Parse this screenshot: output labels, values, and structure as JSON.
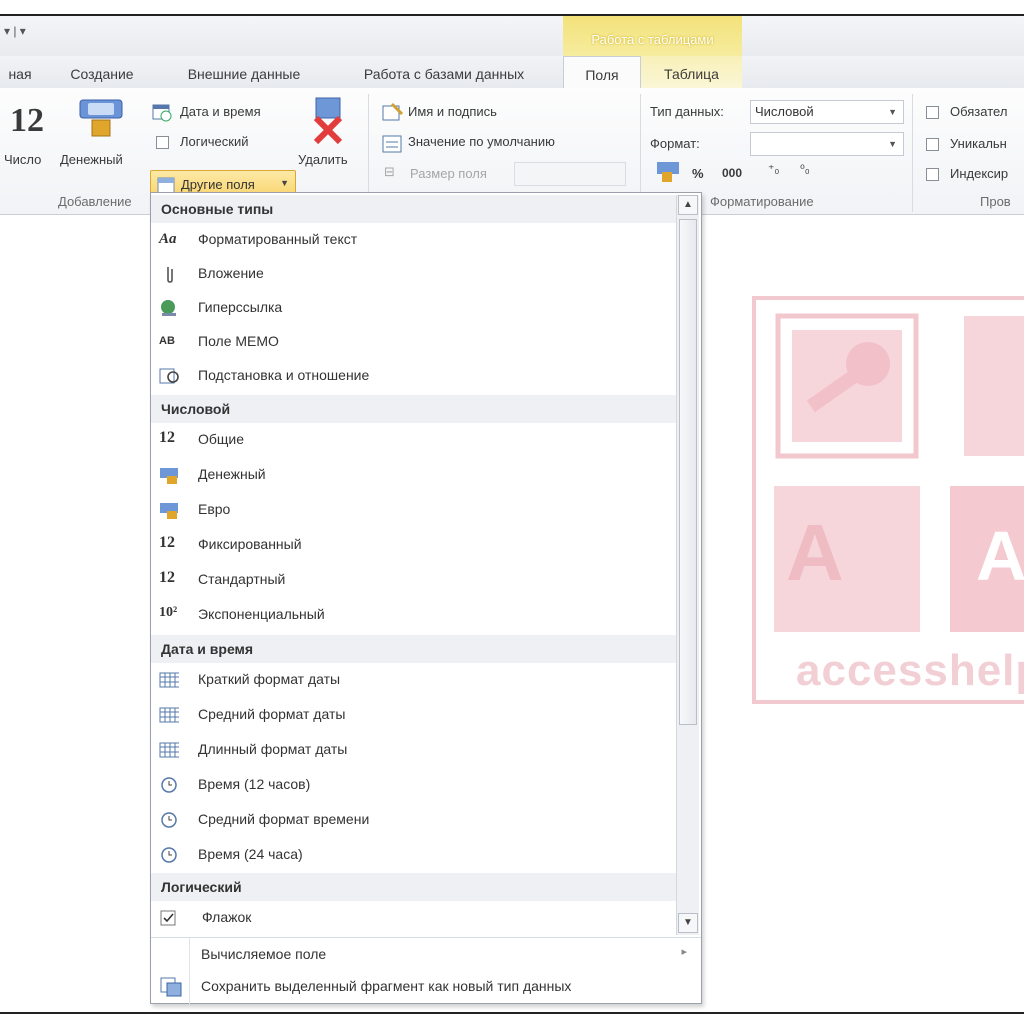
{
  "titlebar": {
    "qat": "▾ | ▾",
    "context_group": "Работа с таблицами"
  },
  "tabs": [
    {
      "label": "ная",
      "active": false
    },
    {
      "label": "Создание",
      "active": false
    },
    {
      "label": "Внешние данные",
      "active": false
    },
    {
      "label": "Работа с базами данных",
      "active": false
    },
    {
      "label": "Поля",
      "active": true
    },
    {
      "label": "Таблица",
      "active": false
    }
  ],
  "ribbon": {
    "add_delete": {
      "number_glyph": "12",
      "number_label": "Число",
      "currency_label": "Денежный",
      "date_time_label": "Дата и время",
      "logical_label": "Логический",
      "other_fields_label": "Другие поля",
      "delete_label": "Удалить",
      "group_label": "Добавление"
    },
    "properties": {
      "name_caption_label": "Имя и подпись",
      "default_value_label": "Значение по умолчанию",
      "field_size_label": "Размер поля"
    },
    "formatting": {
      "data_type_label": "Тип данных:",
      "data_type_value": "Числовой",
      "format_label": "Формат:",
      "format_value": "",
      "percent": "%",
      "thousands": "000",
      "group_label": "Форматирование"
    },
    "validation": {
      "required_label": "Обязател",
      "unique_label": "Уникальн",
      "indexed_label": "Индексир",
      "group_label": "Пров"
    }
  },
  "menu": {
    "sections": [
      {
        "header": "Основные типы",
        "items": [
          {
            "label": "Форматированный текст",
            "icon": "formatted-text-icon"
          },
          {
            "label": "Вложение",
            "icon": "attachment-icon"
          },
          {
            "label": "Гиперссылка",
            "icon": "hyperlink-icon"
          },
          {
            "label": "Поле МЕМО",
            "icon": "memo-icon"
          },
          {
            "label": "Подстановка и отношение",
            "icon": "lookup-icon"
          }
        ]
      },
      {
        "header": "Числовой",
        "items": [
          {
            "label": "Общие",
            "icon": "number-icon"
          },
          {
            "label": "Денежный",
            "icon": "currency-icon"
          },
          {
            "label": "Евро",
            "icon": "currency-icon"
          },
          {
            "label": "Фиксированный",
            "icon": "number-icon"
          },
          {
            "label": "Стандартный",
            "icon": "number-icon"
          },
          {
            "label": "Экспоненциальный",
            "icon": "exponent-icon"
          }
        ]
      },
      {
        "header": "Дата и время",
        "items": [
          {
            "label": "Краткий формат даты",
            "icon": "calendar-icon"
          },
          {
            "label": "Средний формат даты",
            "icon": "calendar-icon"
          },
          {
            "label": "Длинный формат даты",
            "icon": "calendar-icon"
          },
          {
            "label": "Время (12 часов)",
            "icon": "clock-icon"
          },
          {
            "label": "Средний формат времени",
            "icon": "clock-icon"
          },
          {
            "label": "Время (24 часа)",
            "icon": "clock-icon"
          }
        ]
      },
      {
        "header": "Логический",
        "items": [
          {
            "label": "Флажок",
            "icon": "checkbox-icon"
          }
        ]
      }
    ],
    "bottom": {
      "calculated_label": "Вычисляемое поле",
      "save_selection_label": "Сохранить выделенный фрагмент как новый тип данных"
    }
  },
  "watermark": {
    "text": "accesshelp"
  },
  "colors": {
    "context_tab": "#f3e27a",
    "accent_button": "#f8d36a",
    "watermark": "#f1c9cf"
  }
}
